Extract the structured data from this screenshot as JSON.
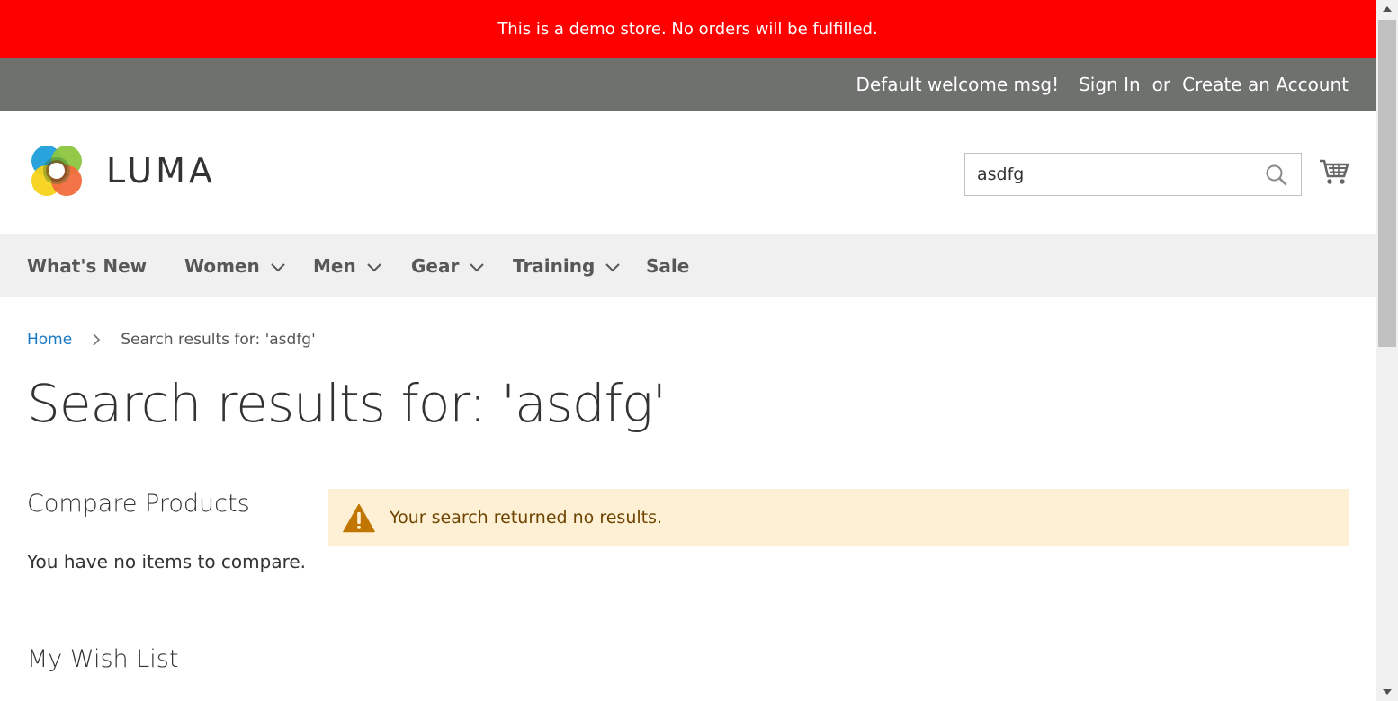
{
  "demo_notice": {
    "text": "This is a demo store. No orders will be fulfilled.",
    "color": "#ff0000"
  },
  "panel": {
    "welcome": "Default welcome msg!",
    "sign_in": "Sign In",
    "or": "or",
    "create_account": "Create an Account",
    "color": "#6e716e"
  },
  "header": {
    "logo_text": "LUMA",
    "search": {
      "value": "asdfg",
      "icon": "search-icon"
    },
    "cart_icon": "cart-icon"
  },
  "nav": {
    "items": [
      {
        "label": "What's New",
        "has_dropdown": false
      },
      {
        "label": "Women",
        "has_dropdown": true
      },
      {
        "label": "Men",
        "has_dropdown": true
      },
      {
        "label": "Gear",
        "has_dropdown": true
      },
      {
        "label": "Training",
        "has_dropdown": true
      },
      {
        "label": "Sale",
        "has_dropdown": false
      }
    ]
  },
  "breadcrumb": {
    "home": "Home",
    "current": "Search results for: 'asdfg'"
  },
  "page_title": "Search results for: 'asdfg'",
  "sidebar": {
    "compare_title": "Compare Products",
    "compare_empty": "You have no items to compare.",
    "wishlist_title": "My Wish List"
  },
  "notice": {
    "text": "Your search returned no results.",
    "icon": "warning-icon",
    "bg_color": "#fdf0d5",
    "text_color": "#6f4400"
  }
}
